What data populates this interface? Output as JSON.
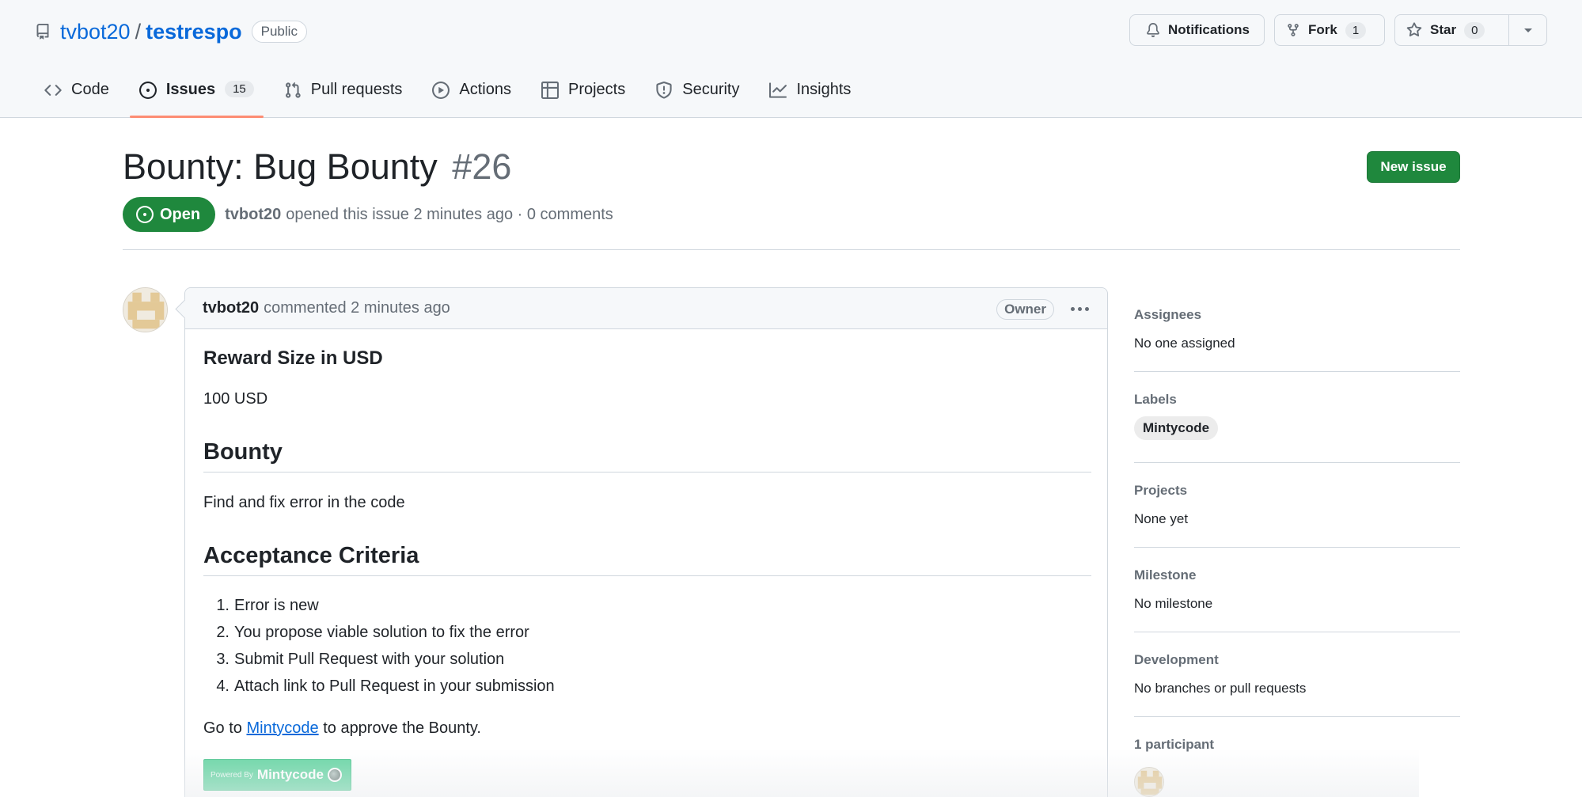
{
  "repo": {
    "owner": "tvbot20",
    "separator": "/",
    "name": "testrespo",
    "visibility": "Public"
  },
  "actions": {
    "notifications_label": "Notifications",
    "fork_label": "Fork",
    "fork_count": "1",
    "star_label": "Star",
    "star_count": "0"
  },
  "nav": {
    "code": "Code",
    "issues": "Issues",
    "issues_count": "15",
    "pull_requests": "Pull requests",
    "actions": "Actions",
    "projects": "Projects",
    "security": "Security",
    "insights": "Insights"
  },
  "issue": {
    "title": "Bounty: Bug Bounty",
    "number": "#26",
    "state": "Open",
    "author": "tvbot20",
    "meta_text": "opened this issue 2 minutes ago · 0 comments",
    "new_issue_label": "New issue"
  },
  "comment": {
    "author": "tvbot20",
    "action_text": "commented 2 minutes ago",
    "role_badge": "Owner",
    "reward_heading": "Reward Size in USD",
    "reward_value": "100 USD",
    "bounty_heading": "Bounty",
    "bounty_text": "Find and fix error in the code",
    "criteria_heading": "Acceptance Criteria",
    "criteria": [
      {
        "num": "1.",
        "text": "Error is new"
      },
      {
        "num": "2.",
        "text": "You propose viable solution to fix the error"
      },
      {
        "num": "3.",
        "text": "Submit Pull Request with your solution"
      },
      {
        "num": "4.",
        "text": "Attach link to Pull Request in your submission"
      }
    ],
    "goto_prefix": "Go to",
    "goto_link": "Mintycode",
    "goto_suffix": "to approve the Bounty.",
    "powered_small": "Powered By",
    "powered_brand": "Mintycode"
  },
  "sidebar": {
    "assignees_label": "Assignees",
    "assignees_value": "No one assigned",
    "labels_label": "Labels",
    "label_chip": "Mintycode",
    "projects_label": "Projects",
    "projects_value": "None yet",
    "milestone_label": "Milestone",
    "milestone_value": "No milestone",
    "development_label": "Development",
    "development_value": "No branches or pull requests",
    "participants_label": "1 participant"
  },
  "colors": {
    "open_green": "#1f883d",
    "link_blue": "#0969da",
    "nav_underline": "#fd8c73",
    "mintycode_green": "#66d5a3"
  },
  "icons": [
    "repo-icon",
    "bell-icon",
    "fork-icon",
    "star-icon",
    "caret-down-icon",
    "code-icon",
    "issue-opened-icon",
    "pull-request-icon",
    "play-icon",
    "table-icon",
    "shield-icon",
    "graph-icon",
    "kebab-icon",
    "identicon-avatar"
  ]
}
